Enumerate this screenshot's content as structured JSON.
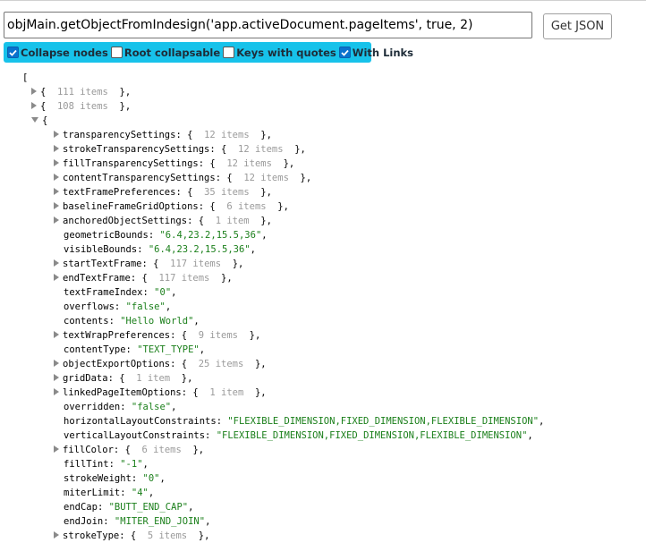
{
  "query": {
    "value": "objMain.getObjectFromIndesign('app.activeDocument.pageItems', true, 2)"
  },
  "get_button_label": "Get JSON",
  "options": [
    {
      "label": "Collapse nodes",
      "checked": true
    },
    {
      "label": "Root collapsable",
      "checked": false
    },
    {
      "label": "Keys with quotes",
      "checked": false
    },
    {
      "label": "With Links",
      "checked": true
    }
  ],
  "tree": {
    "open_bracket": "[",
    "collapsed_items": [
      {
        "count": "111 items"
      },
      {
        "count": "108 items"
      }
    ],
    "expanded_open": "{",
    "entries": [
      {
        "key": "transparencySettings",
        "count": "12 items"
      },
      {
        "key": "strokeTransparencySettings",
        "count": "12 items"
      },
      {
        "key": "fillTransparencySettings",
        "count": "12 items"
      },
      {
        "key": "contentTransparencySettings",
        "count": "12 items"
      },
      {
        "key": "textFramePreferences",
        "count": "35 items"
      },
      {
        "key": "baselineFrameGridOptions",
        "count": "6 items"
      },
      {
        "key": "anchoredObjectSettings",
        "count": "1 item"
      },
      {
        "key": "geometricBounds",
        "value": "\"6.4,23.2,15.5,36\""
      },
      {
        "key": "visibleBounds",
        "value": "\"6.4,23.2,15.5,36\""
      },
      {
        "key": "startTextFrame",
        "count": "117 items"
      },
      {
        "key": "endTextFrame",
        "count": "117 items"
      },
      {
        "key": "textFrameIndex",
        "value": "\"0\""
      },
      {
        "key": "overflows",
        "value": "\"false\""
      },
      {
        "key": "contents",
        "value": "\"Hello World\""
      },
      {
        "key": "textWrapPreferences",
        "count": "9 items"
      },
      {
        "key": "contentType",
        "value": "\"TEXT_TYPE\""
      },
      {
        "key": "objectExportOptions",
        "count": "25 items"
      },
      {
        "key": "gridData",
        "count": "1 item"
      },
      {
        "key": "linkedPageItemOptions",
        "count": "1 item"
      },
      {
        "key": "overridden",
        "value": "\"false\""
      },
      {
        "key": "horizontalLayoutConstraints",
        "value": "\"FLEXIBLE_DIMENSION,FIXED_DIMENSION,FLEXIBLE_DIMENSION\""
      },
      {
        "key": "verticalLayoutConstraints",
        "value": "\"FLEXIBLE_DIMENSION,FIXED_DIMENSION,FLEXIBLE_DIMENSION\""
      },
      {
        "key": "fillColor",
        "count": "6 items"
      },
      {
        "key": "fillTint",
        "value": "\"-1\""
      },
      {
        "key": "strokeWeight",
        "value": "\"0\""
      },
      {
        "key": "miterLimit",
        "value": "\"4\""
      },
      {
        "key": "endCap",
        "value": "\"BUTT_END_CAP\""
      },
      {
        "key": "endJoin",
        "value": "\"MITER_END_JOIN\""
      },
      {
        "key": "strokeType",
        "count": "5 items"
      }
    ]
  },
  "colors": {
    "option_bar": "#17c2ea",
    "checkbox_on": "#0a72ce",
    "string_value": "#1a7f1a",
    "item_count": "#9a9a9a"
  }
}
